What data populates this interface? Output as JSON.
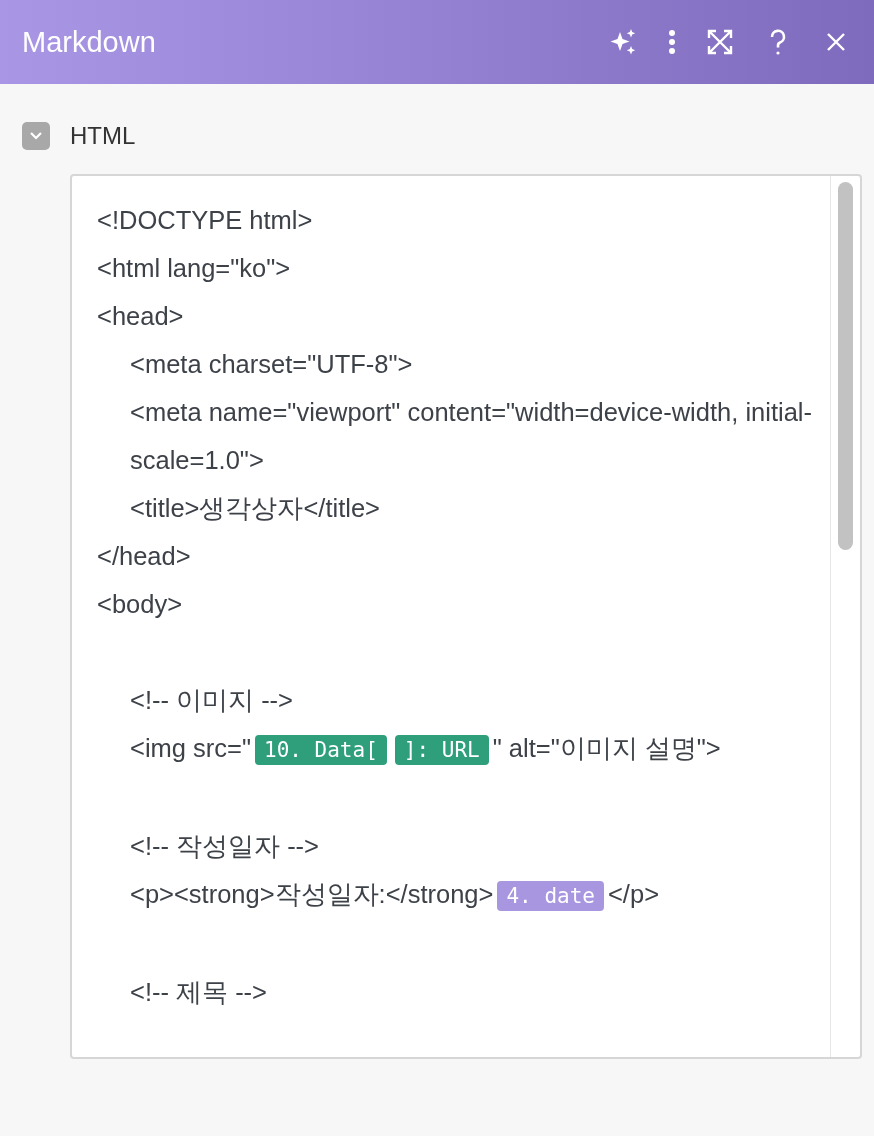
{
  "header": {
    "title": "Markdown"
  },
  "section": {
    "label": "HTML",
    "expanded": true
  },
  "editor": {
    "lines": [
      {
        "kind": "code",
        "indented": false,
        "segments": [
          {
            "kind": "text",
            "text": "<!DOCTYPE html>"
          }
        ]
      },
      {
        "kind": "code",
        "indented": false,
        "segments": [
          {
            "kind": "text",
            "text": "<html lang=\"ko\">"
          }
        ]
      },
      {
        "kind": "code",
        "indented": false,
        "segments": [
          {
            "kind": "text",
            "text": "<head>"
          }
        ]
      },
      {
        "kind": "code",
        "indented": true,
        "segments": [
          {
            "kind": "text",
            "text": "<meta charset=\"UTF-8\">"
          }
        ]
      },
      {
        "kind": "code",
        "indented": true,
        "segments": [
          {
            "kind": "text",
            "text": "<meta name=\"viewport\" content=\"width=device-width, initial-scale=1.0\">"
          }
        ]
      },
      {
        "kind": "code",
        "indented": true,
        "segments": [
          {
            "kind": "text",
            "text": "<title>생각상자</title>"
          }
        ]
      },
      {
        "kind": "code",
        "indented": false,
        "segments": [
          {
            "kind": "text",
            "text": "</head>"
          }
        ]
      },
      {
        "kind": "code",
        "indented": false,
        "segments": [
          {
            "kind": "text",
            "text": "<body>"
          }
        ]
      },
      {
        "kind": "blank"
      },
      {
        "kind": "code",
        "indented": true,
        "segments": [
          {
            "kind": "text",
            "text": "<!-- 이미지 -->"
          }
        ]
      },
      {
        "kind": "code",
        "indented": true,
        "segments": [
          {
            "kind": "text",
            "text": "<img src=\""
          },
          {
            "kind": "token",
            "text": "10. Data[",
            "color": "#2e9e7b"
          },
          {
            "kind": "token",
            "text": "]: URL",
            "color": "#2e9e7b"
          },
          {
            "kind": "text",
            "text": "\" alt=\"이미지 설명\">"
          }
        ]
      },
      {
        "kind": "blank"
      },
      {
        "kind": "code",
        "indented": true,
        "segments": [
          {
            "kind": "text",
            "text": "<!-- 작성일자 -->"
          }
        ]
      },
      {
        "kind": "code",
        "indented": true,
        "segments": [
          {
            "kind": "text",
            "text": "<p><strong>작성일자:</strong>"
          },
          {
            "kind": "token",
            "text": "4. date",
            "color": "#a896e0"
          },
          {
            "kind": "text",
            "text": "</p>"
          }
        ]
      },
      {
        "kind": "blank"
      },
      {
        "kind": "code",
        "indented": true,
        "segments": [
          {
            "kind": "text",
            "text": "<!-- 제목 -->"
          }
        ]
      }
    ]
  }
}
